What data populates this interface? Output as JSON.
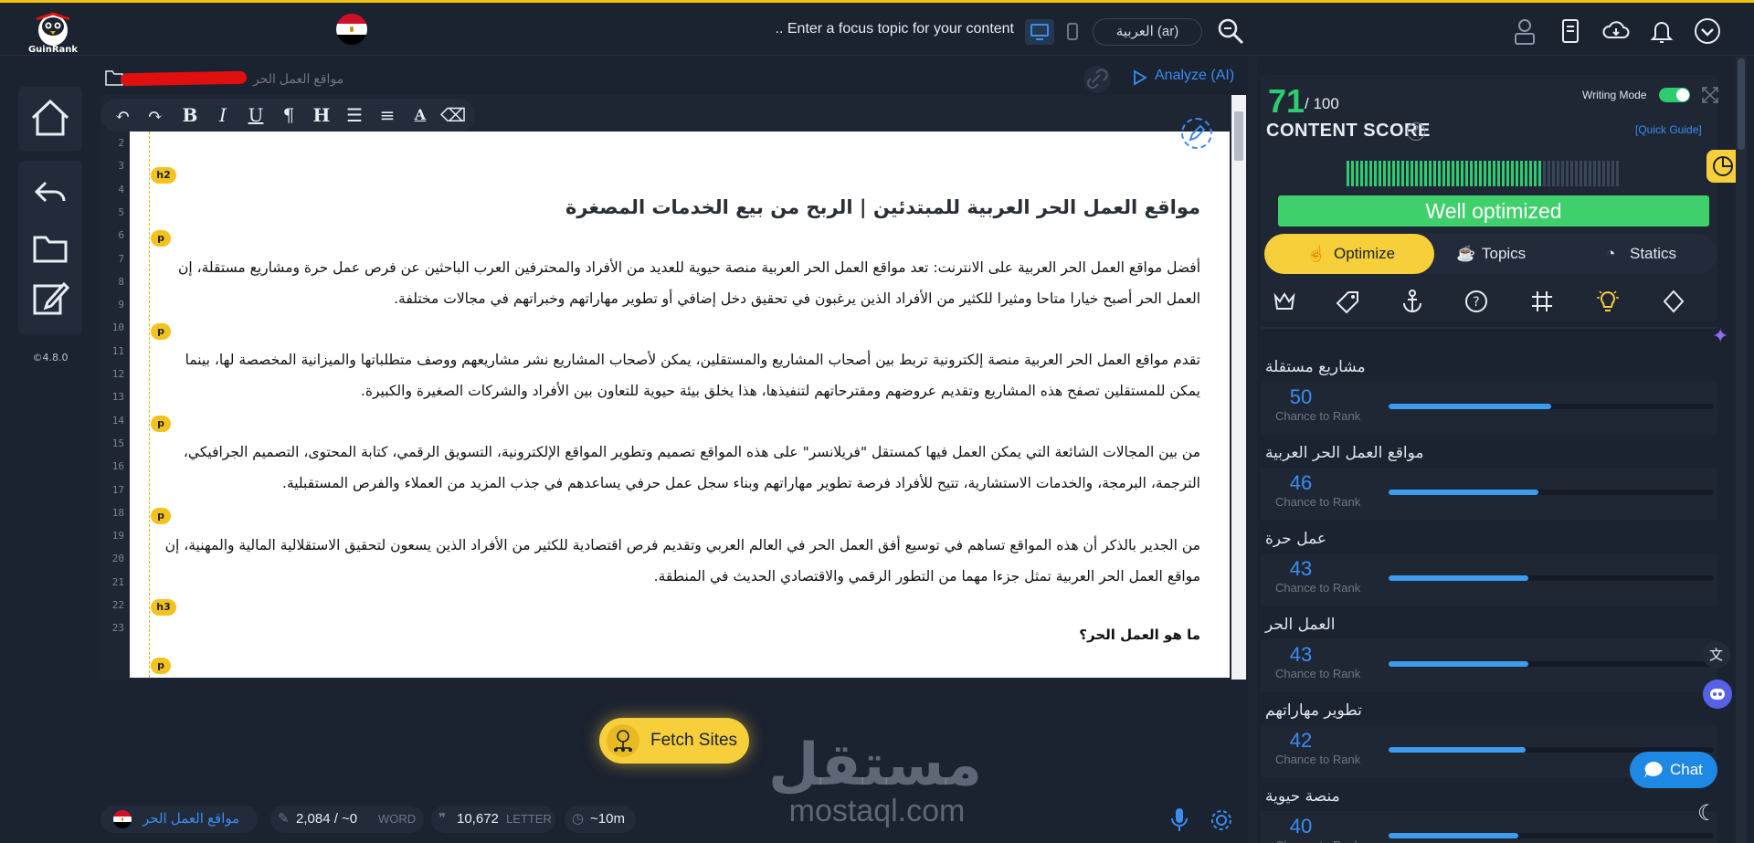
{
  "app": {
    "logo_text": "GuinRank",
    "version": "©4.8.0"
  },
  "topbar": {
    "focus_placeholder": ".. Enter a focus topic for your content",
    "language": "العربية (ar)"
  },
  "editor": {
    "breadcrumb": "مواقع العمل الحر",
    "analyze_label": "Analyze (AI)",
    "line_numbers": [
      "2",
      "3",
      "4",
      "5",
      "6",
      "7",
      "8",
      "9",
      "10",
      "11",
      "12",
      "13",
      "14",
      "15",
      "16",
      "17",
      "18",
      "19",
      "20",
      "21",
      "22",
      "23"
    ],
    "tags": [
      "h2",
      "p",
      "p",
      "p",
      "p",
      "h3",
      "p"
    ],
    "title": "مواقع العمل الحر العربية للمبتدئين | الربح من بيع الخدمات المصغرة",
    "paragraphs": [
      "أفضل مواقع العمل الحر العربية على الانترنت: تعد مواقع العمل الحر العربية منصة حيوية للعديد من الأفراد والمحترفين العرب الباحثين عن فرص عمل حرة ومشاريع مستقلة، إن العمل الحر أصبح خيارا متاحا ومثيرا للكثير من الأفراد الذين يرغبون في تحقيق دخل إضافي أو تطوير مهاراتهم وخبراتهم في مجالات مختلفة.",
      "تقدم مواقع العمل الحر العربية منصة إلكترونية تربط بين أصحاب المشاريع والمستقلين، يمكن لأصحاب المشاريع نشر مشاريعهم ووصف متطلباتها والميزانية المخصصة لها، بينما يمكن للمستقلين تصفح هذه المشاريع وتقديم عروضهم ومقترحاتهم لتنفيذها، هذا يخلق بيئة حيوية للتعاون بين الأفراد والشركات الصغيرة والكبيرة.",
      "من بين المجالات الشائعة التي يمكن العمل فيها كمستقل \"فريلانسر\" على هذه المواقع تصميم وتطوير المواقع الإلكترونية، التسويق الرقمي، كتابة المحتوى، التصميم الجرافيكي، الترجمة، البرمجة، والخدمات الاستشارية، تتيح للأفراد فرصة تطوير مهاراتهم وبناء سجل عمل حرفي يساعدهم في جذب المزيد من العملاء والفرص المستقبلية.",
      "من الجدير بالذكر أن هذه المواقع تساهم في توسيع أفق العمل الحر في العالم العربي وتقديم فرص اقتصادية للكثير من الأفراد الذين يسعون لتحقيق الاستقلالية المالية والمهنية، إن مواقع العمل الحر العربية تمثل جزءا مهما من التطور الرقمي والاقتصادي الحديث في المنطقة."
    ],
    "subheading": "ما هو العمل الحر؟",
    "fetch_label": "Fetch Sites"
  },
  "watermark": {
    "arabic": "مستقل",
    "latin": "mostaql.com"
  },
  "status": {
    "keyword": "مواقع العمل الحر",
    "words": "2,084 / ~0",
    "words_unit": "WORD",
    "letters": "10,672",
    "letters_unit": "LETTER",
    "time": "~10m"
  },
  "panel": {
    "score": "71",
    "score_max": "/ 100",
    "score_label": "CONTENT SCORE",
    "writing_mode": "Writing Mode",
    "quick_guide": "[Quick Guide]",
    "status_text": "Well optimized",
    "tabs": [
      "Optimize",
      "Topics",
      "Statics"
    ],
    "chance_label": "Chance to Rank",
    "keywords": [
      {
        "name": "مشاريع مستقلة",
        "score": 50
      },
      {
        "name": "مواقع العمل الحر العربية",
        "score": 46
      },
      {
        "name": "عمل حرة",
        "score": 43
      },
      {
        "name": "العمل الحر",
        "score": 43
      },
      {
        "name": "تطوير مهاراتهم",
        "score": 42
      },
      {
        "name": "منصة حيوية",
        "score": 40
      }
    ],
    "chat_label": "Chat"
  },
  "colors": {
    "accent_yellow": "#f7cf3a",
    "score_green": "#2ecc71",
    "link_blue": "#3b8df0"
  }
}
